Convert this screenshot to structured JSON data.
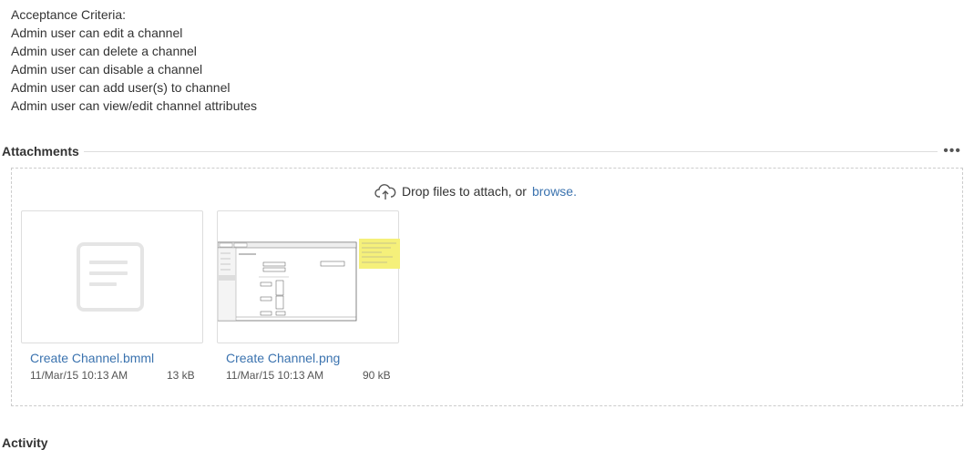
{
  "criteria": {
    "heading": "Acceptance Criteria:",
    "items": [
      "Admin user can edit a channel",
      "Admin user can delete a channel",
      "Admin user can disable a channel",
      "Admin user can add user(s) to channel",
      "Admin user can view/edit channel attributes"
    ]
  },
  "attachments": {
    "title": "Attachments",
    "more_icon": "ellipsis-icon",
    "drop_text": "Drop files to attach, or",
    "browse_label": "browse.",
    "upload_icon": "cloud-upload-icon",
    "files": [
      {
        "name": "Create Channel.bmml",
        "date": "11/Mar/15 10:13 AM",
        "size": "13 kB",
        "icon": "document-icon"
      },
      {
        "name": "Create Channel.png",
        "date": "11/Mar/15 10:13 AM",
        "size": "90 kB",
        "icon": "image-thumbnail"
      }
    ]
  },
  "activity": {
    "title": "Activity"
  },
  "colors": {
    "link": "#3b73af",
    "border": "#dddddd",
    "note": "#f5f07a"
  }
}
